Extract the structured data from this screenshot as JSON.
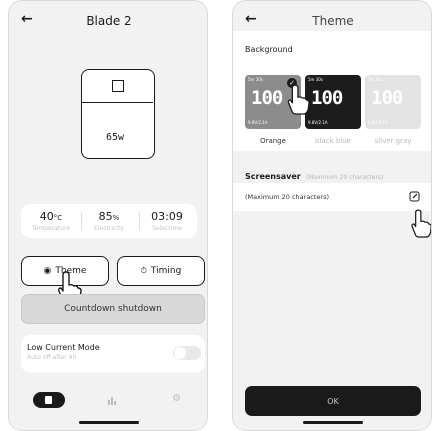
{
  "left": {
    "header": {
      "title": "Blade 2"
    },
    "device": {
      "reading": "65w"
    },
    "stats": [
      {
        "value": "40",
        "unit": "°C",
        "label": "Temperature"
      },
      {
        "value": "85",
        "unit": "%",
        "label": "Electricity"
      },
      {
        "value": "03:09",
        "unit": "",
        "label": "Selectime"
      }
    ],
    "buttons": {
      "theme": "Theme",
      "timing": "Timing",
      "countdown": "Countdown shutdown"
    },
    "low_current": {
      "title": "Low Current Mode",
      "subtitle": "Auto off after 4h"
    }
  },
  "right": {
    "header": {
      "title": "Theme"
    },
    "background_label": "Background",
    "themes": [
      {
        "name": "Orange",
        "display": "100",
        "bg": "#8c8c8c",
        "fg": "#ffffff",
        "selected": true
      },
      {
        "name": "black blue",
        "display": "100",
        "bg": "#1c1c1c",
        "fg": "#ffffff",
        "selected": false
      },
      {
        "name": "silver gray",
        "display": "100",
        "bg": "#e3e3e3",
        "fg": "#ffffff",
        "selected": false
      }
    ],
    "thumb_top": "5m 30s",
    "thumb_bottom": "9.8V/2.1A",
    "screensaver": {
      "title": "Screensaver",
      "hint": "(Maximum 20 characters)",
      "placeholder": "(Maximum 20 characters)"
    },
    "ok_label": "OK"
  },
  "colors": {
    "dark": "#1a1a1a",
    "muted": "#b8b8b8",
    "screen_bg": "#f2f2f2"
  }
}
